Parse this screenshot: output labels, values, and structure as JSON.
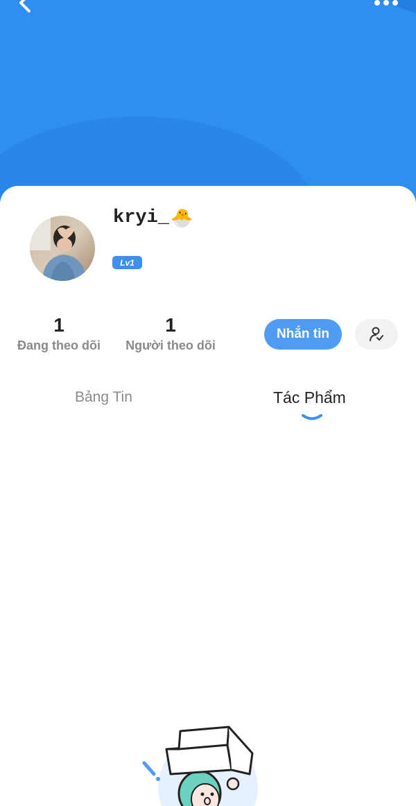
{
  "profile": {
    "username": "kryi_",
    "username_emoji": "🐣",
    "level": "Lv1"
  },
  "stats": [
    {
      "count": "1",
      "label": "Đang theo dõi"
    },
    {
      "count": "1",
      "label": "Người theo dõi"
    }
  ],
  "actions": {
    "message_label": "Nhắn tin"
  },
  "tabs": [
    {
      "label": "Bảng Tin",
      "active": false
    },
    {
      "label": "Tác Phẩm",
      "active": true
    }
  ],
  "colors": {
    "header_blue": "#2f8ff0",
    "accent_blue": "#4e9cf3",
    "text_dark": "#222222",
    "text_muted": "#8a8a8a"
  },
  "icons": [
    "back-icon",
    "more-icon",
    "follow-user-icon",
    "empty-state-illustration"
  ]
}
